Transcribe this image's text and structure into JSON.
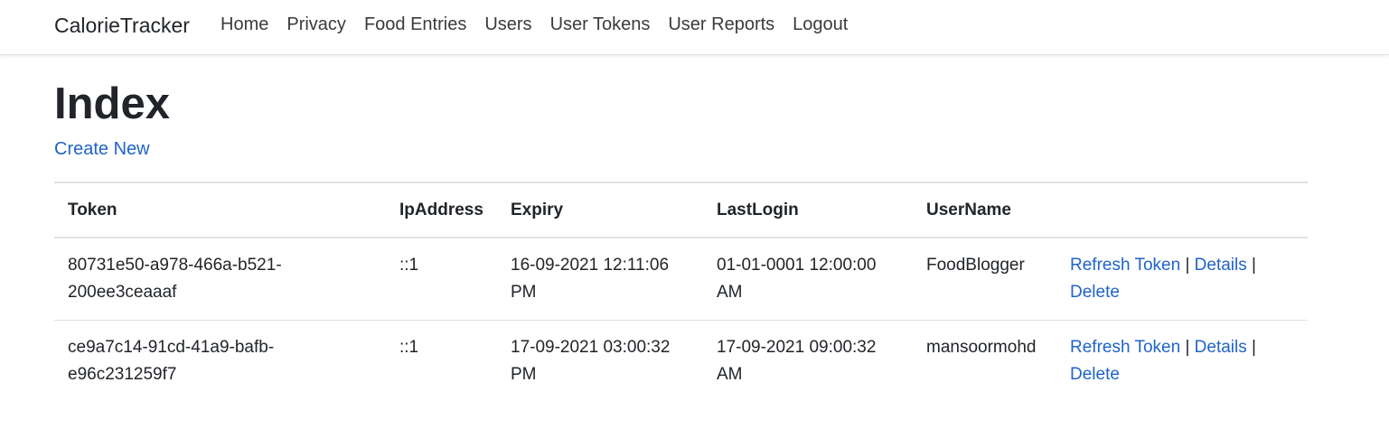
{
  "navbar": {
    "brand": "CalorieTracker",
    "items": [
      {
        "label": "Home"
      },
      {
        "label": "Privacy"
      },
      {
        "label": "Food Entries"
      },
      {
        "label": "Users"
      },
      {
        "label": "User Tokens"
      },
      {
        "label": "User Reports"
      },
      {
        "label": "Logout"
      }
    ]
  },
  "page": {
    "title": "Index",
    "create_link": "Create New"
  },
  "table": {
    "headers": {
      "token": "Token",
      "ip": "IpAddress",
      "expiry": "Expiry",
      "last_login": "LastLogin",
      "username": "UserName"
    },
    "rows": [
      {
        "token": "80731e50-a978-466a-b521-200ee3ceaaaf",
        "ip": "::1",
        "expiry": "16-09-2021 12:11:06 PM",
        "last_login": "01-01-0001 12:00:00 AM",
        "username": "FoodBlogger"
      },
      {
        "token": "ce9a7c14-91cd-41a9-bafb-e96c231259f7",
        "ip": "::1",
        "expiry": "17-09-2021 03:00:32 PM",
        "last_login": "17-09-2021 09:00:32 AM",
        "username": "mansoormohd"
      }
    ],
    "actions": {
      "refresh": "Refresh Token",
      "details": "Details",
      "delete": "Delete",
      "separator": "|"
    }
  },
  "colors": {
    "link": "#1f63c9",
    "text": "#212529",
    "border": "#dee2e6"
  }
}
